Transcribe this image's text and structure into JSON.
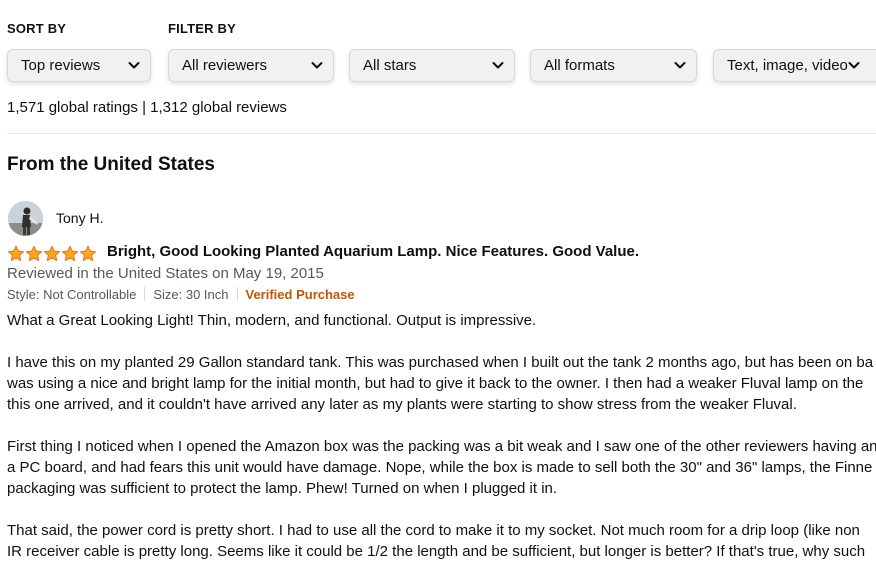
{
  "sort": {
    "label": "SORT BY",
    "selected": "Top reviews"
  },
  "filter": {
    "label": "FILTER BY",
    "reviewers": "All reviewers",
    "stars": "All stars",
    "formats": "All formats",
    "media": "Text, image, video"
  },
  "summary": "1,571 global ratings | 1,312 global reviews",
  "section_heading": "From the United States",
  "review": {
    "author": "Tony H.",
    "rating": 5,
    "title": "Bright, Good Looking Planted Aquarium Lamp. Nice Features. Good Value.",
    "date": "Reviewed in the United States on May 19, 2015",
    "style": "Style: Not Controllable",
    "size": "Size: 30 Inch",
    "verified": "Verified Purchase",
    "star_color": "#ffa41c",
    "body": {
      "p1": "What a Great Looking Light! Thin, modern, and functional. Output is impressive.",
      "p2_l1": "I have this on my planted 29 Gallon standard tank. This was purchased when I built out the tank 2 months ago, but has been on ba",
      "p2_l2": "was using a nice and bright lamp for the initial month, but had to give it back to the owner. I then had a weaker Fluval lamp on the",
      "p2_l3": "this one arrived, and it couldn't have arrived any later as my plants were starting to show stress from the weaker Fluval.",
      "p3_l1": "First thing I noticed when I opened the Amazon box was the packing was a bit weak and I saw one of the other reviewers having an",
      "p3_l2": "a PC board, and had fears this unit would have damage. Nope, while the box is made to sell both the 30\" and 36\" lamps, the Finne",
      "p3_l3": "packaging was sufficient to protect the lamp. Phew! Turned on when I plugged it in.",
      "p4_l1": "That said, the power cord is pretty short. I had to use all the cord to make it to my socket. Not much room for a drip loop (like non",
      "p4_l2": "IR receiver cable is pretty long. Seems like it could be 1/2 the length and be sufficient, but longer is better? If that's true, why such"
    }
  }
}
